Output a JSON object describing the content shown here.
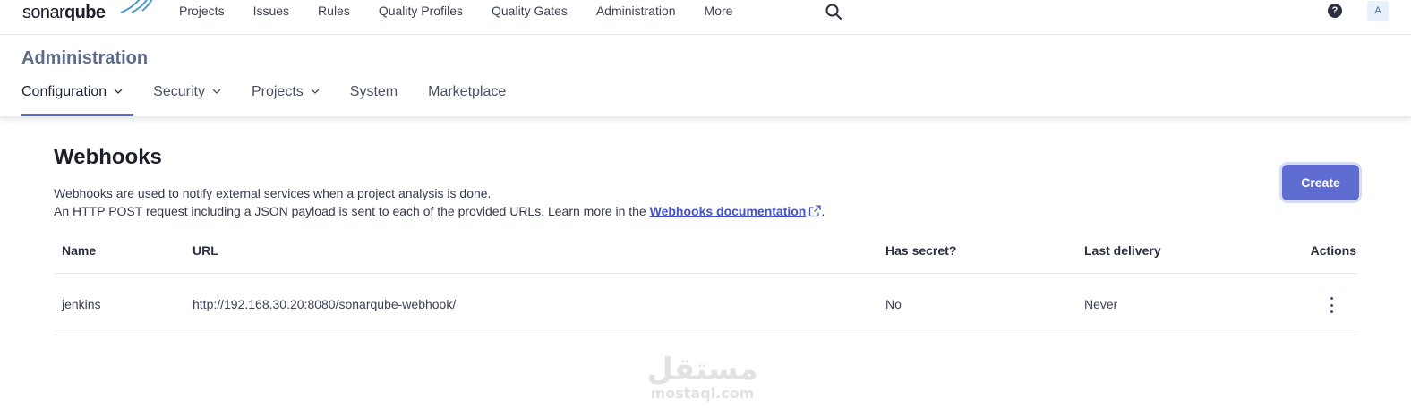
{
  "topnav": {
    "logo_plain": "sonar",
    "logo_bold": "qube",
    "items": [
      {
        "label": "Projects"
      },
      {
        "label": "Issues"
      },
      {
        "label": "Rules"
      },
      {
        "label": "Quality Profiles"
      },
      {
        "label": "Quality Gates"
      },
      {
        "label": "Administration"
      },
      {
        "label": "More"
      }
    ],
    "help_label": "?",
    "avatar_initial": "A"
  },
  "admin": {
    "title": "Administration",
    "tabs": [
      {
        "label": "Configuration",
        "has_dropdown": true,
        "active": true
      },
      {
        "label": "Security",
        "has_dropdown": true
      },
      {
        "label": "Projects",
        "has_dropdown": true
      },
      {
        "label": "System"
      },
      {
        "label": "Marketplace"
      }
    ]
  },
  "webhooks": {
    "title": "Webhooks",
    "desc_line1": "Webhooks are used to notify external services when a project analysis is done.",
    "desc_line2": "An HTTP POST request including a JSON payload is sent to each of the provided URLs. Learn more in the",
    "doc_link": "Webhooks documentation",
    "desc_end": ".",
    "create_label": "Create",
    "table": {
      "columns": [
        "Name",
        "URL",
        "Has secret?",
        "Last delivery",
        "Actions"
      ],
      "rows": [
        {
          "name": "jenkins",
          "url": "http://192.168.30.20:8080/sonarqube-webhook/",
          "has_secret": "No",
          "last_delivery": "Never"
        }
      ]
    }
  },
  "watermark": {
    "arabic": "مستقل",
    "latin": "mostaql.com"
  },
  "colors": {
    "accent": "#5f6dd3",
    "link": "#4353c4",
    "admin_title": "#5d6b8a"
  }
}
